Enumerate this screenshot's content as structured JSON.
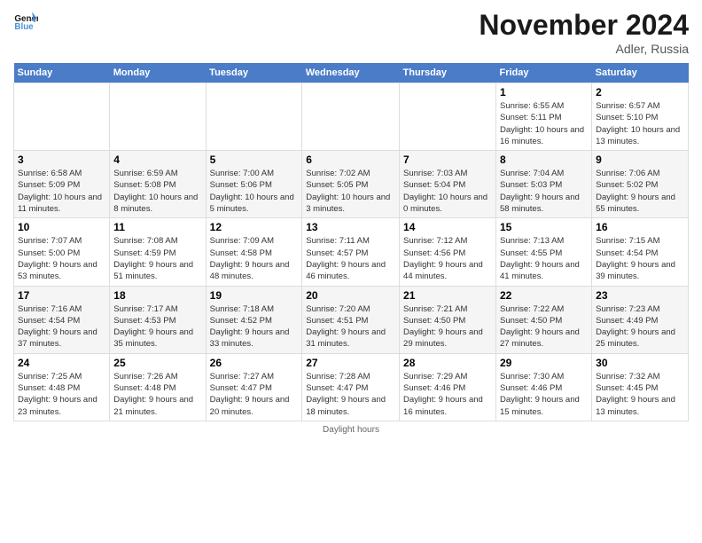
{
  "header": {
    "logo_line1": "General",
    "logo_line2": "Blue",
    "month_title": "November 2024",
    "location": "Adler, Russia"
  },
  "footer": {
    "text": "Daylight hours"
  },
  "weekdays": [
    "Sunday",
    "Monday",
    "Tuesday",
    "Wednesday",
    "Thursday",
    "Friday",
    "Saturday"
  ],
  "weeks": [
    [
      {
        "day": "",
        "info": ""
      },
      {
        "day": "",
        "info": ""
      },
      {
        "day": "",
        "info": ""
      },
      {
        "day": "",
        "info": ""
      },
      {
        "day": "",
        "info": ""
      },
      {
        "day": "1",
        "info": "Sunrise: 6:55 AM\nSunset: 5:11 PM\nDaylight: 10 hours and 16 minutes."
      },
      {
        "day": "2",
        "info": "Sunrise: 6:57 AM\nSunset: 5:10 PM\nDaylight: 10 hours and 13 minutes."
      }
    ],
    [
      {
        "day": "3",
        "info": "Sunrise: 6:58 AM\nSunset: 5:09 PM\nDaylight: 10 hours and 11 minutes."
      },
      {
        "day": "4",
        "info": "Sunrise: 6:59 AM\nSunset: 5:08 PM\nDaylight: 10 hours and 8 minutes."
      },
      {
        "day": "5",
        "info": "Sunrise: 7:00 AM\nSunset: 5:06 PM\nDaylight: 10 hours and 5 minutes."
      },
      {
        "day": "6",
        "info": "Sunrise: 7:02 AM\nSunset: 5:05 PM\nDaylight: 10 hours and 3 minutes."
      },
      {
        "day": "7",
        "info": "Sunrise: 7:03 AM\nSunset: 5:04 PM\nDaylight: 10 hours and 0 minutes."
      },
      {
        "day": "8",
        "info": "Sunrise: 7:04 AM\nSunset: 5:03 PM\nDaylight: 9 hours and 58 minutes."
      },
      {
        "day": "9",
        "info": "Sunrise: 7:06 AM\nSunset: 5:02 PM\nDaylight: 9 hours and 55 minutes."
      }
    ],
    [
      {
        "day": "10",
        "info": "Sunrise: 7:07 AM\nSunset: 5:00 PM\nDaylight: 9 hours and 53 minutes."
      },
      {
        "day": "11",
        "info": "Sunrise: 7:08 AM\nSunset: 4:59 PM\nDaylight: 9 hours and 51 minutes."
      },
      {
        "day": "12",
        "info": "Sunrise: 7:09 AM\nSunset: 4:58 PM\nDaylight: 9 hours and 48 minutes."
      },
      {
        "day": "13",
        "info": "Sunrise: 7:11 AM\nSunset: 4:57 PM\nDaylight: 9 hours and 46 minutes."
      },
      {
        "day": "14",
        "info": "Sunrise: 7:12 AM\nSunset: 4:56 PM\nDaylight: 9 hours and 44 minutes."
      },
      {
        "day": "15",
        "info": "Sunrise: 7:13 AM\nSunset: 4:55 PM\nDaylight: 9 hours and 41 minutes."
      },
      {
        "day": "16",
        "info": "Sunrise: 7:15 AM\nSunset: 4:54 PM\nDaylight: 9 hours and 39 minutes."
      }
    ],
    [
      {
        "day": "17",
        "info": "Sunrise: 7:16 AM\nSunset: 4:54 PM\nDaylight: 9 hours and 37 minutes."
      },
      {
        "day": "18",
        "info": "Sunrise: 7:17 AM\nSunset: 4:53 PM\nDaylight: 9 hours and 35 minutes."
      },
      {
        "day": "19",
        "info": "Sunrise: 7:18 AM\nSunset: 4:52 PM\nDaylight: 9 hours and 33 minutes."
      },
      {
        "day": "20",
        "info": "Sunrise: 7:20 AM\nSunset: 4:51 PM\nDaylight: 9 hours and 31 minutes."
      },
      {
        "day": "21",
        "info": "Sunrise: 7:21 AM\nSunset: 4:50 PM\nDaylight: 9 hours and 29 minutes."
      },
      {
        "day": "22",
        "info": "Sunrise: 7:22 AM\nSunset: 4:50 PM\nDaylight: 9 hours and 27 minutes."
      },
      {
        "day": "23",
        "info": "Sunrise: 7:23 AM\nSunset: 4:49 PM\nDaylight: 9 hours and 25 minutes."
      }
    ],
    [
      {
        "day": "24",
        "info": "Sunrise: 7:25 AM\nSunset: 4:48 PM\nDaylight: 9 hours and 23 minutes."
      },
      {
        "day": "25",
        "info": "Sunrise: 7:26 AM\nSunset: 4:48 PM\nDaylight: 9 hours and 21 minutes."
      },
      {
        "day": "26",
        "info": "Sunrise: 7:27 AM\nSunset: 4:47 PM\nDaylight: 9 hours and 20 minutes."
      },
      {
        "day": "27",
        "info": "Sunrise: 7:28 AM\nSunset: 4:47 PM\nDaylight: 9 hours and 18 minutes."
      },
      {
        "day": "28",
        "info": "Sunrise: 7:29 AM\nSunset: 4:46 PM\nDaylight: 9 hours and 16 minutes."
      },
      {
        "day": "29",
        "info": "Sunrise: 7:30 AM\nSunset: 4:46 PM\nDaylight: 9 hours and 15 minutes."
      },
      {
        "day": "30",
        "info": "Sunrise: 7:32 AM\nSunset: 4:45 PM\nDaylight: 9 hours and 13 minutes."
      }
    ]
  ]
}
